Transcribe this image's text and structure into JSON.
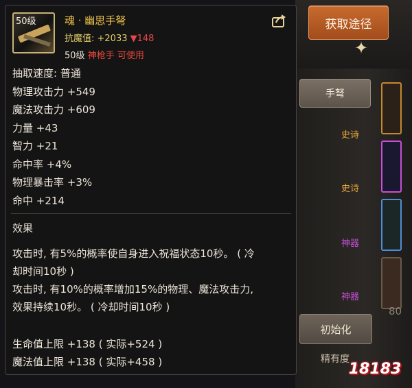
{
  "item": {
    "level_badge": "50级",
    "name": "魂 · 幽思手弩",
    "resist_label": "抗魔值: ",
    "resist_value": "+2033",
    "resist_diff": "▼148",
    "req_level": "50级",
    "req_class": "神枪手 可使用",
    "stats": [
      "抽取速度: 普通",
      "物理攻击力 +549",
      "魔法攻击力 +609",
      "力量 +43",
      "智力 +21",
      "命中率 +4%",
      "物理暴击率 +3%",
      "命中 +214"
    ],
    "effect_title": "效果",
    "effect_lines": [
      "攻击时, 有5%的概率使自身进入祝福状态10秒。 ( 冷",
      "却时间10秒 )",
      "攻击时, 有10%的概率增加15%的物理、魔法攻击力,",
      "效果持续10秒。 ( 冷却时间10秒 )"
    ],
    "bonus_lines": [
      "生命值上限 +138 ( 实际+524 )",
      "魔法值上限 +138 ( 实际+458 )"
    ]
  },
  "side": {
    "source_button": "获取途径",
    "category_button": "手弩",
    "rarity_labels": [
      "史诗",
      "史诗",
      "神器",
      "神器"
    ],
    "init_button": "初始化",
    "sub_button": "精有度",
    "counter": "80",
    "logo": "18183"
  },
  "colors": {
    "name": "#f2c74a",
    "epic": "#e9a93a",
    "artifact": "#c84fd8",
    "down": "#e5474a"
  },
  "icons": [
    "share-icon",
    "star-icon",
    "weapon-icon"
  ]
}
